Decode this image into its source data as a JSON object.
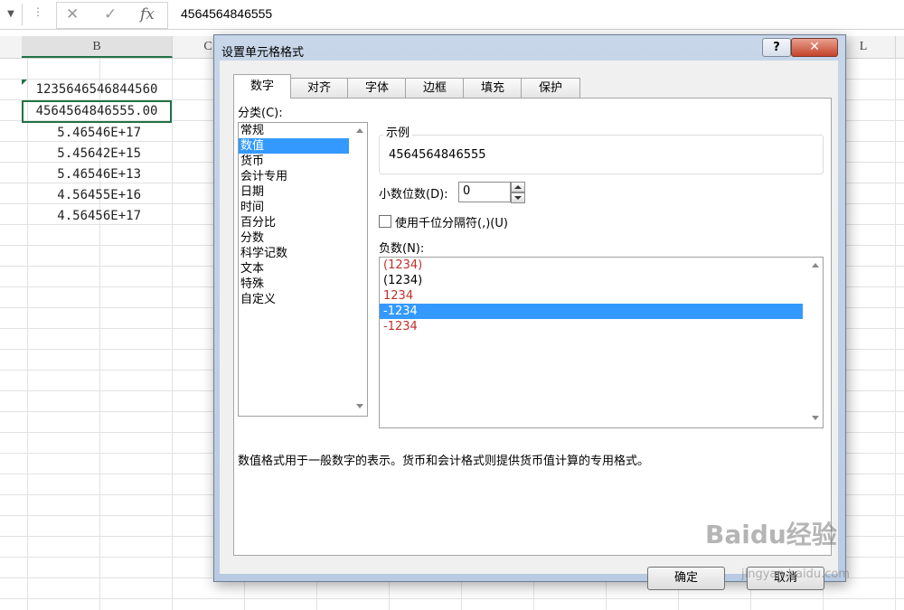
{
  "formula_bar": {
    "x_icon": "✕",
    "check_icon": "✓",
    "fx_icon": "fx",
    "value": "4564564846555"
  },
  "columns": [
    "B",
    "C",
    "L"
  ],
  "cells": {
    "b2": "1235646546844560",
    "b3": "4564564846555.00",
    "b4": "5.46546E+17",
    "b5": "5.45642E+15",
    "b6": "5.46546E+13",
    "b7": "4.56455E+16",
    "b8": "4.56456E+17"
  },
  "dialog": {
    "title": "设置单元格格式",
    "help": "?",
    "close": "✕",
    "tabs": [
      "数字",
      "对齐",
      "字体",
      "边框",
      "填充",
      "保护"
    ],
    "category_label": "分类(C):",
    "categories": [
      "常规",
      "数值",
      "货币",
      "会计专用",
      "日期",
      "时间",
      "百分比",
      "分数",
      "科学记数",
      "文本",
      "特殊",
      "自定义"
    ],
    "selected_category": "数值",
    "sample_label": "示例",
    "sample_value": "4564564846555",
    "decimals_label": "小数位数(D):",
    "decimals_value": "0",
    "thousands_label": "使用千位分隔符(,)(U)",
    "negative_label": "负数(N):",
    "negative_options": [
      "(1234)",
      "(1234)",
      "1234",
      "-1234",
      "-1234"
    ],
    "negative_colors": [
      "#c0302a",
      "#000000",
      "#c0302a",
      "#ffffff",
      "#c0302a"
    ],
    "description": "数值格式用于一般数字的表示。货币和会计格式则提供货币值计算的专用格式。",
    "ok": "确定",
    "cancel": "取消"
  },
  "watermark": {
    "brand": "Baidu经验",
    "url": "jingyan.baidu.com"
  }
}
